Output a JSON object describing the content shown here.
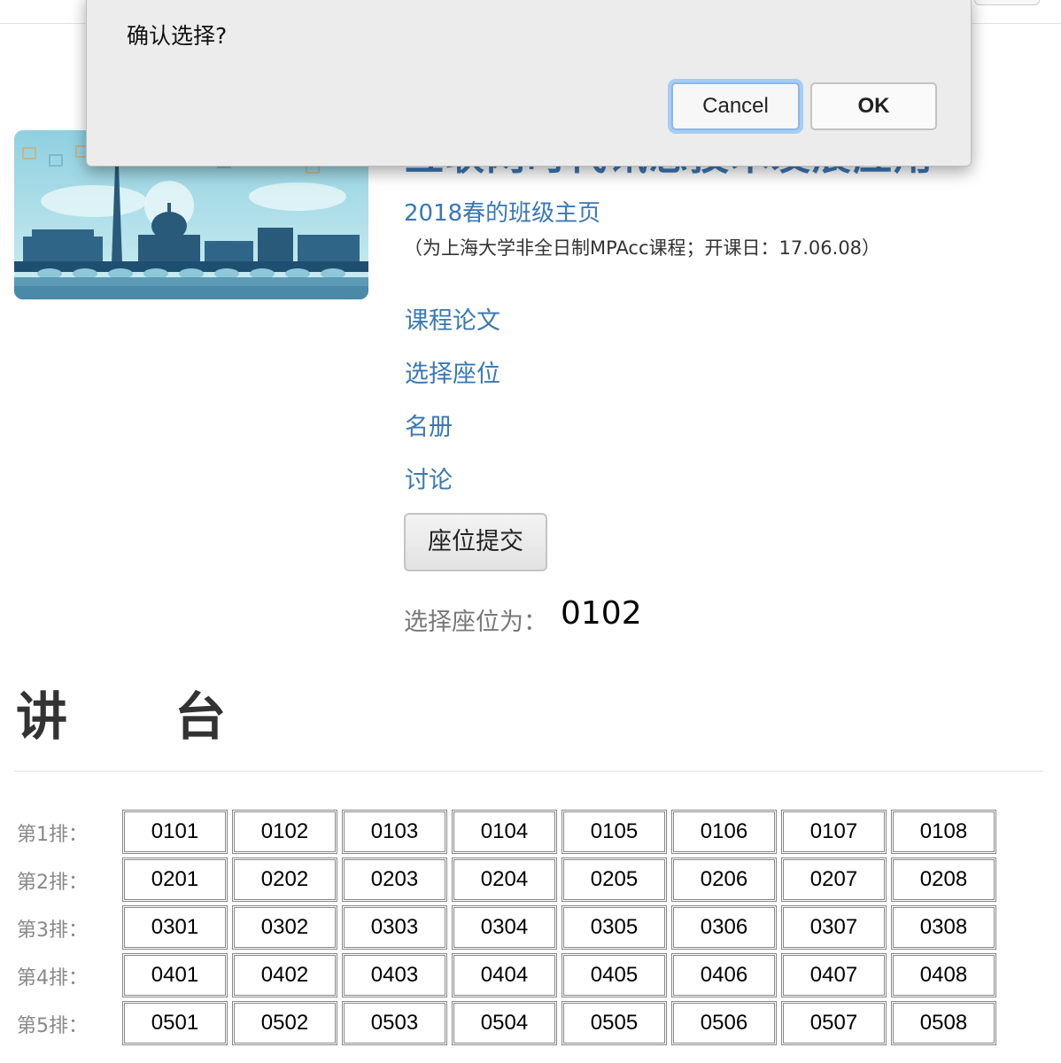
{
  "course": {
    "title": "互联网时代讯息技术发展应用",
    "homepage_link": "2018春的班级主页",
    "note": "（为上海大学非全日制MPAcc课程；开课日：17.06.08）"
  },
  "nav": {
    "items": [
      "课程论文",
      "选择座位",
      "名册",
      "讨论"
    ]
  },
  "submit_button": "座位提交",
  "selection": {
    "label": "选择座位为：",
    "value": "0102"
  },
  "podium_label": "讲      台",
  "seating": {
    "rows": [
      {
        "label": "第1排：",
        "seats": [
          "0101",
          "0102",
          "0103",
          "0104",
          "0105",
          "0106",
          "0107",
          "0108"
        ]
      },
      {
        "label": "第2排：",
        "seats": [
          "0201",
          "0202",
          "0203",
          "0204",
          "0205",
          "0206",
          "0207",
          "0208"
        ]
      },
      {
        "label": "第3排：",
        "seats": [
          "0301",
          "0302",
          "0303",
          "0304",
          "0305",
          "0306",
          "0307",
          "0308"
        ]
      },
      {
        "label": "第4排：",
        "seats": [
          "0401",
          "0402",
          "0403",
          "0404",
          "0405",
          "0406",
          "0407",
          "0408"
        ]
      },
      {
        "label": "第5排：",
        "seats": [
          "0501",
          "0502",
          "0503",
          "0504",
          "0505",
          "0506",
          "0507",
          "0508"
        ]
      }
    ]
  },
  "dialog": {
    "message": "确认选择?",
    "cancel_label": "Cancel",
    "ok_label": "OK"
  },
  "colors": {
    "link": "#3a78b5",
    "focus_ring": "#a7cdf3"
  }
}
